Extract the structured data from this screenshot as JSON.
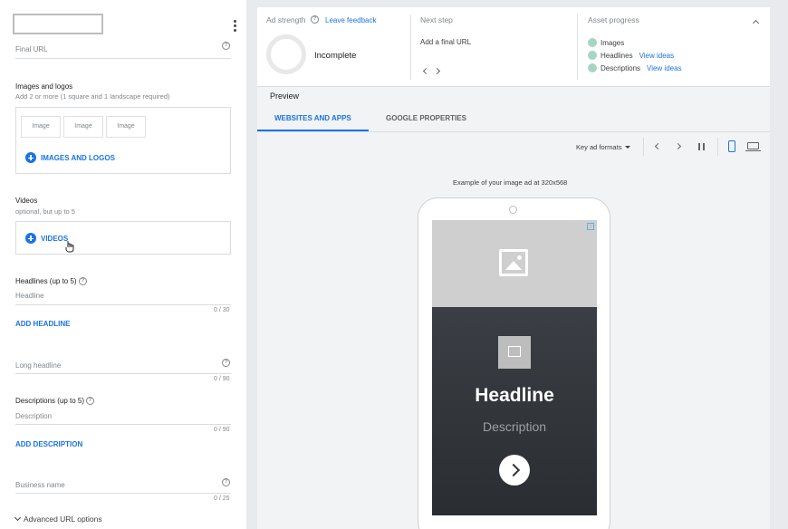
{
  "form": {
    "name_value": "",
    "final_url_placeholder": "Final URL",
    "images": {
      "title": "Images and logos",
      "subtitle": "Add 2 or more (1 square and 1 landscape required)",
      "slots": [
        "Image",
        "Image",
        "Image"
      ],
      "add_label": "IMAGES AND LOGOS"
    },
    "videos": {
      "title": "Videos",
      "subtitle": "optional, but up to 5",
      "add_label": "VIDEOS"
    },
    "headlines": {
      "title": "Headlines (up to 5)",
      "placeholder": "Headline",
      "counter": "0 / 30",
      "add_label": "ADD HEADLINE"
    },
    "long_headline": {
      "placeholder": "Long headline",
      "counter": "0 / 90"
    },
    "descriptions": {
      "title": "Descriptions (up to 5)",
      "placeholder": "Description",
      "counter": "0 / 90",
      "add_label": "ADD DESCRIPTION"
    },
    "business_name": {
      "placeholder": "Business name",
      "counter": "0 / 25"
    },
    "advanced_label": "Advanced URL options",
    "help_glyph": "?"
  },
  "strength": {
    "title": "Ad strength",
    "feedback_label": "Leave feedback",
    "status": "Incomplete"
  },
  "next_step": {
    "title": "Next step",
    "text": "Add a final URL"
  },
  "asset_progress": {
    "title": "Asset progress",
    "items": [
      {
        "label": "Images",
        "link": ""
      },
      {
        "label": "Headlines",
        "link": "View ideas"
      },
      {
        "label": "Descriptions",
        "link": "View ideas"
      }
    ]
  },
  "preview": {
    "title": "Preview",
    "tabs": [
      {
        "label": "WEBSITES AND APPS",
        "active": true
      },
      {
        "label": "GOOGLE PROPERTIES",
        "active": false
      }
    ],
    "key_formats_label": "Key ad formats",
    "example_text": "Example of your image ad at 320x568",
    "ad": {
      "headline": "Headline",
      "description": "Description",
      "ad_choices_glyph": "i"
    }
  },
  "colors": {
    "accent": "#1a73e8",
    "progress_dot": "#a8d5c2",
    "ad_dark": "#2f3237"
  }
}
